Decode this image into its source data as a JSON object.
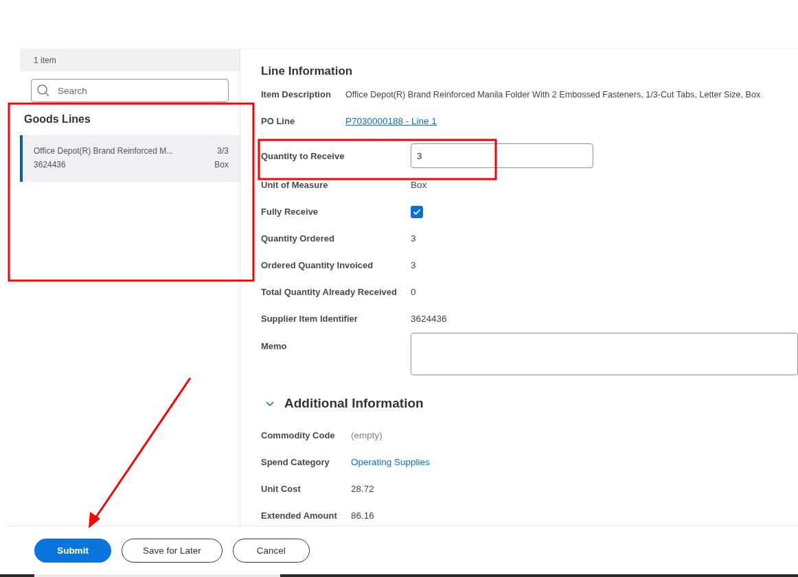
{
  "goods_panel": {
    "count": "1 item",
    "search": {
      "placeholder": "Search"
    },
    "title": "Goods Lines",
    "lines": [
      {
        "description": "Office Depot(R) Brand Reinforced M...",
        "quantity": "3/3",
        "identifier": "3624436",
        "unit": "Box",
        "selected": true
      }
    ]
  },
  "line_information": {
    "title": "Line Information",
    "summary": [
      {
        "kind": "text",
        "label": "Item Description",
        "value": "Office Depot(R) Brand Reinforced Manila Folder With 2 Embossed Fasteners, 1/3-Cut Tabs, Letter Size, Box"
      },
      {
        "kind": "link",
        "label": "PO Line",
        "value": "P7030000188 - Line 1"
      }
    ],
    "fields": [
      {
        "kind": "input",
        "label": "Quantity to Receive",
        "value": "3"
      },
      {
        "kind": "text",
        "label": "Unit of Measure",
        "value": "Box"
      },
      {
        "kind": "checkbox",
        "label": "Fully Receive",
        "checked": true
      },
      {
        "kind": "text",
        "label": "Quantity Ordered",
        "value": "3"
      },
      {
        "kind": "text",
        "label": "Ordered Quantity Invoiced",
        "value": "3"
      },
      {
        "kind": "text",
        "label": "Total Quantity Already Received",
        "value": "0"
      },
      {
        "kind": "text",
        "label": "Supplier Item Identifier",
        "value": "3624436"
      },
      {
        "kind": "textarea",
        "label": "Memo"
      }
    ]
  },
  "additional_information": {
    "title": "Additional Information",
    "expanded": true,
    "fields": [
      {
        "kind": "empty",
        "label": "Commodity Code",
        "value": "(empty)"
      },
      {
        "kind": "link",
        "label": "Spend Category",
        "value": "Operating Supplies"
      },
      {
        "kind": "text",
        "label": "Unit Cost",
        "value": "28.72"
      },
      {
        "kind": "text",
        "label": "Extended Amount",
        "value": "86.16"
      }
    ]
  },
  "buttons": [
    {
      "label": "Submit",
      "kind": "primary"
    },
    {
      "label": "Save for Later",
      "kind": "secondary"
    },
    {
      "label": "Cancel",
      "kind": "secondary"
    }
  ]
}
